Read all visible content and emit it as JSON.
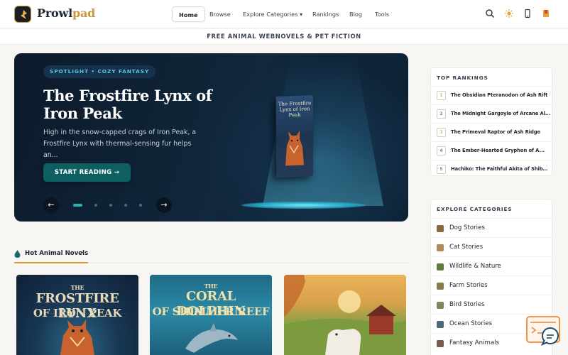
{
  "nav": {
    "brand_prefix": "Prowl",
    "brand_suffix": "pad",
    "links": [
      "Home",
      "Browse",
      "Explore Categories ▾",
      "Rankings",
      "Blog",
      "Tools"
    ],
    "icons": [
      "search-icon",
      "sun-icon",
      "phone-icon",
      "bookmark-icon"
    ]
  },
  "subbanner": "FREE ANIMAL WEBNOVELS & PET FICTION",
  "hero": {
    "tag": "SPOTLIGHT • COZY FANTASY",
    "title": "The Frostfire Lynx of Iron Peak",
    "description": "High in the snow-capped crags of Iron Peak, a Frostfire Lynx with thermal-sensing fur helps an...",
    "cta": "START READING →",
    "book_title": "The Frostfire Lynx of Iron Peak",
    "prev": "←",
    "next": "→",
    "slide_count": 5,
    "active_slide": 1
  },
  "rankings": {
    "title": "TOP RANKINGS",
    "items": [
      {
        "num": "1",
        "title": "The Obsidian Pteranodon of Ash Rift"
      },
      {
        "num": "2",
        "title": "The Midnight Gargoyle of Arcane Al..."
      },
      {
        "num": "3",
        "title": "The Primeval Raptor of Ash Ridge"
      },
      {
        "num": "4",
        "title": "The Ember-Hearted Gryphon of A..."
      },
      {
        "num": "5",
        "title": "Hachiko: The Faithful Akita of Shibuya"
      }
    ]
  },
  "categories": {
    "title": "EXPLORE CATEGORIES",
    "items": [
      {
        "label": "Dog Stories",
        "color": "#8a6a3a"
      },
      {
        "label": "Cat Stories",
        "color": "#b08a5a"
      },
      {
        "label": "Wildlife & Nature",
        "color": "#5f7a3a"
      },
      {
        "label": "Farm Stories",
        "color": "#8a7a4a"
      },
      {
        "label": "Bird Stories",
        "color": "#7a8a5a"
      },
      {
        "label": "Ocean Stories",
        "color": "#4a6a7a"
      },
      {
        "label": "Fantasy Animals",
        "color": "#7a5a4a"
      }
    ]
  },
  "hot": {
    "label": "Hot Animal Novels",
    "chevron": "›",
    "cards": [
      {
        "the": "THE",
        "title": "FROSTFIRE LYNX",
        "sub": "OF IRON PEAK"
      },
      {
        "the": "THE",
        "title": "CORAL DOLPHIN",
        "sub": "OF SHIMMER REEF"
      },
      {
        "the": "",
        "title": "",
        "sub": ""
      }
    ]
  },
  "colors": {
    "accent": "#c8963c",
    "teal": "#0d5f62",
    "hero_bg": "#0c1a2a"
  }
}
